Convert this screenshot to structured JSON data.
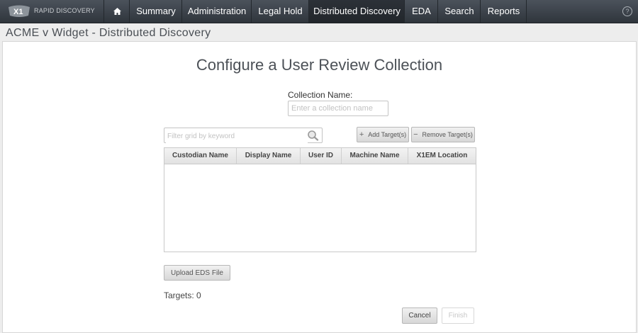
{
  "nav": {
    "brand": "RAPID DISCOVERY",
    "items": [
      {
        "label": "Summary",
        "active": false
      },
      {
        "label": "Administration",
        "active": false
      },
      {
        "label": "Legal Hold",
        "active": false
      },
      {
        "label": "Distributed Discovery",
        "active": true
      },
      {
        "label": "EDA",
        "active": false
      },
      {
        "label": "Search",
        "active": false
      },
      {
        "label": "Reports",
        "active": false
      }
    ],
    "help_glyph": "?"
  },
  "page": {
    "title": "ACME v Widget - Distributed Discovery",
    "heading": "Configure a User Review Collection"
  },
  "form": {
    "collection_name_label": "Collection Name:",
    "collection_name_value": "",
    "collection_name_placeholder": "Enter a collection name",
    "filter_value": "",
    "filter_placeholder": "Filter grid by keyword"
  },
  "toolbar": {
    "add_label": "Add Target(s)",
    "add_symbol": "+",
    "remove_label": "Remove Target(s)",
    "remove_symbol": "−"
  },
  "grid": {
    "columns": [
      "Custodian Name",
      "Display Name",
      "User ID",
      "Machine Name",
      "X1EM Location"
    ],
    "rows": []
  },
  "actions": {
    "upload_label": "Upload EDS File",
    "targets_label": "Targets: 0",
    "cancel_label": "Cancel",
    "finish_label": "Finish"
  },
  "colors": {
    "nav_bg": "#3a4047",
    "accent_text": "#4c5157"
  }
}
